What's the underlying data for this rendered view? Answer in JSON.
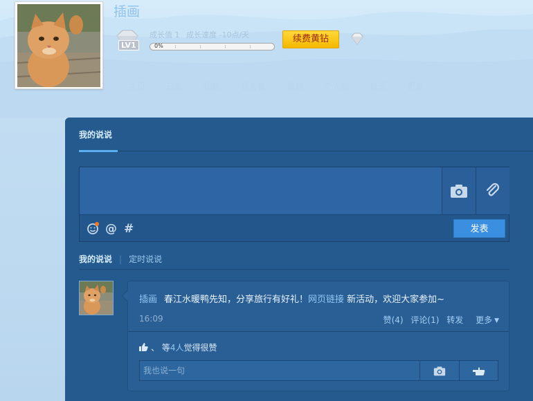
{
  "profile": {
    "name": "插画",
    "level_label": "LV1",
    "growth_value_label": "成长值 1",
    "growth_speed_label": "成长速度 -10点/天",
    "progress": {
      "percent": 0,
      "label": "0%"
    },
    "renew_button": "续费黄钻"
  },
  "nav": {
    "items": [
      "主页",
      "日志",
      "相册",
      "留言板",
      "说说",
      "个人档",
      "音乐",
      "更多"
    ]
  },
  "panel": {
    "tab_title": "我的说说",
    "composer": {
      "text": "",
      "publish_label": "发表"
    },
    "subtabs": {
      "active": "我的说说",
      "separator": "|",
      "other": "定时说说"
    }
  },
  "feed": {
    "author": "插画",
    "text_before_link": "春江水暖鸭先知，分享旅行有好礼！",
    "link_text": "网页链接",
    "text_after_link": " 新活动，欢迎大家参加~",
    "time": "16:09",
    "actions": {
      "like": "赞(4)",
      "comment": "评论(1)",
      "share": "转发",
      "more": "更多"
    },
    "likes": {
      "prefix": "、 等",
      "count": "4人",
      "suffix": "觉得很赞"
    },
    "comment_placeholder": "我也说一句"
  },
  "icons": {
    "camera": "camera-icon",
    "link": "paperclip-icon",
    "emoji": "emoji-icon",
    "at": "at-icon",
    "hashtag": "hashtag-icon",
    "thumb": "thumbs-up-icon",
    "hand": "pointing-hand-icon",
    "diamond": "diamond-icon"
  },
  "colors": {
    "panel": "#245a8e",
    "accent": "#3a8fe0",
    "link": "#8dc8f5",
    "renew": "#f5b800"
  }
}
